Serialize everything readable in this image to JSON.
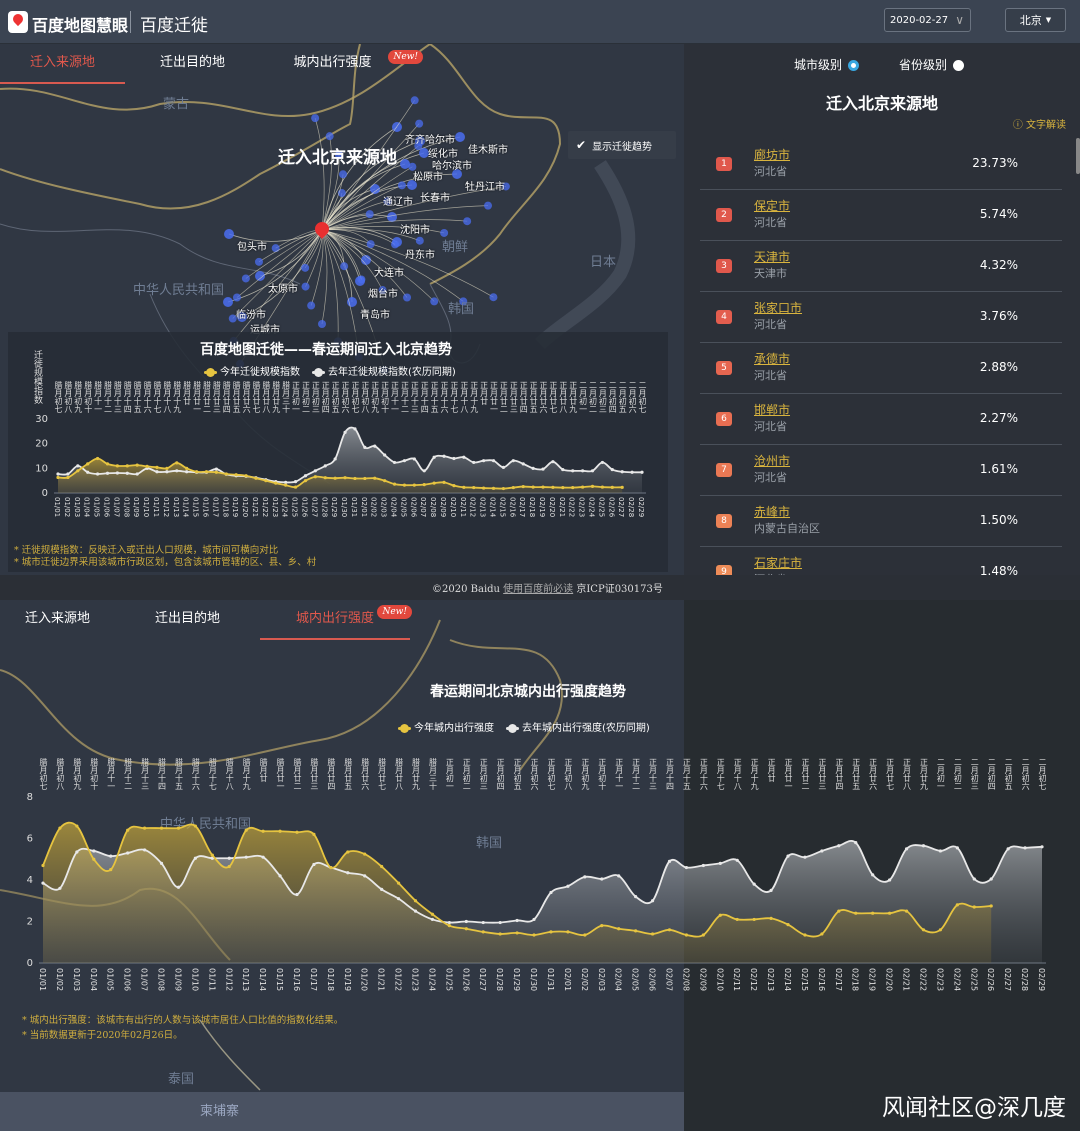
{
  "header": {
    "brand": "百度地图慧眼",
    "title": "百度迁徙",
    "date": "2020-02-27",
    "city": "北京"
  },
  "tabs": [
    {
      "label": "迁入来源地"
    },
    {
      "label": "迁出目的地"
    },
    {
      "label": "城内出行强度",
      "badge": "New!"
    }
  ],
  "top_map": {
    "title": "迁入北京来源地",
    "trend_toggle": "显示迁徙趋势",
    "countries": [
      "蒙古",
      "中华人民共和国",
      "朝鲜",
      "韩国",
      "日本"
    ],
    "cities": [
      "齐齐哈尔市",
      "绥化市",
      "佳木斯市",
      "哈尔滨市",
      "松原市",
      "牡丹江市",
      "长春市",
      "通辽市",
      "沈阳市",
      "丹东市",
      "大连市",
      "烟台市",
      "青岛市",
      "包头市",
      "太原市",
      "临汾市",
      "运城市"
    ]
  },
  "migration_chart": {
    "title": "百度地图迁徙——春运期间迁入北京趋势",
    "notes": [
      "* 迁徙规模指数：反映迁入或迁出人口规模，城市间可横向对比",
      "* 城市迁徙边界采用该城市行政区划，包含该城市管辖的区、县、乡、村"
    ]
  },
  "right_panel": {
    "level_city": "城市级别",
    "level_province": "省份级别",
    "title": "迁入北京来源地",
    "explain": "文字解读",
    "rows": [
      {
        "rank": "1",
        "city": "廊坊市",
        "province": "河北省",
        "pct": "23.73%"
      },
      {
        "rank": "2",
        "city": "保定市",
        "province": "河北省",
        "pct": "5.74%"
      },
      {
        "rank": "3",
        "city": "天津市",
        "province": "天津市",
        "pct": "4.32%"
      },
      {
        "rank": "4",
        "city": "张家口市",
        "province": "河北省",
        "pct": "3.76%"
      },
      {
        "rank": "5",
        "city": "承德市",
        "province": "河北省",
        "pct": "2.88%"
      },
      {
        "rank": "6",
        "city": "邯郸市",
        "province": "河北省",
        "pct": "2.27%"
      },
      {
        "rank": "7",
        "city": "沧州市",
        "province": "河北省",
        "pct": "1.61%"
      },
      {
        "rank": "8",
        "city": "赤峰市",
        "province": "内蒙古自治区",
        "pct": "1.50%"
      },
      {
        "rank": "9",
        "city": "石家庄市",
        "province": "河北省",
        "pct": "1.48%"
      }
    ]
  },
  "footer": {
    "copyright": "©2020 Baidu",
    "link": "使用百度前必读",
    "icp": "京ICP证030173号"
  },
  "bottom_map": {
    "countries": [
      "中华人民共和国",
      "韩国",
      "泰国",
      "柬埔寨"
    ]
  },
  "intensity_chart": {
    "notes": [
      "* 城内出行强度：该城市有出行的人数与该城市居住人口比值的指数化结果。",
      "* 当前数据更新于2020年02月26日。"
    ]
  },
  "watermark": "风闻社区@深几度",
  "colors": {
    "accent": "#e0584c",
    "this_year": "#e6c440",
    "last_year": "#e8e8e8",
    "link": "#d9b43e"
  },
  "chart_data": [
    {
      "type": "area",
      "title": "百度地图迁徙——春运期间迁入北京趋势",
      "ylabel": "迁徙规模指数",
      "ylim": [
        0,
        30
      ],
      "yticks": [
        0,
        10,
        20,
        30
      ],
      "grid": false,
      "legend": "top",
      "categories": [
        "01/01",
        "01/02",
        "01/03",
        "01/04",
        "01/05",
        "01/06",
        "01/07",
        "01/08",
        "01/09",
        "01/10",
        "01/11",
        "01/12",
        "01/13",
        "01/14",
        "01/15",
        "01/16",
        "01/17",
        "01/18",
        "01/19",
        "01/20",
        "01/21",
        "01/22",
        "01/23",
        "01/24",
        "01/25",
        "01/26",
        "01/27",
        "01/28",
        "01/29",
        "01/30",
        "01/31",
        "02/01",
        "02/02",
        "02/03",
        "02/04",
        "02/05",
        "02/06",
        "02/07",
        "02/08",
        "02/09",
        "02/10",
        "02/11",
        "02/12",
        "02/13",
        "02/14",
        "02/15",
        "02/16",
        "02/17",
        "02/18",
        "02/19",
        "02/20",
        "02/21",
        "02/22",
        "02/23",
        "02/24",
        "02/25",
        "02/26",
        "02/27",
        "02/28",
        "02/29"
      ],
      "lunar_categories": [
        "腊月初七",
        "腊月初八",
        "腊月初九",
        "腊月初十",
        "腊月十一",
        "腊月十二",
        "腊月十三",
        "腊月十四",
        "腊月十五",
        "腊月十六",
        "腊月十七",
        "腊月十八",
        "腊月十九",
        "腊月廿",
        "腊月廿一",
        "腊月廿二",
        "腊月廿三",
        "腊月廿四",
        "腊月廿五",
        "腊月廿六",
        "腊月廿七",
        "腊月廿八",
        "腊月廿九",
        "腊月三十",
        "正月初一",
        "正月初二",
        "正月初三",
        "正月初四",
        "正月初五",
        "正月初六",
        "正月初七",
        "正月初八",
        "正月初九",
        "正月初十",
        "正月十一",
        "正月十二",
        "正月十三",
        "正月十四",
        "正月十五",
        "正月十六",
        "正月十七",
        "正月十八",
        "正月十九",
        "正月廿",
        "正月廿一",
        "正月廿二",
        "正月廿三",
        "正月廿四",
        "正月廿五",
        "正月廿六",
        "正月廿七",
        "正月廿八",
        "正月廿九",
        "二月初一",
        "二月初二",
        "二月初三",
        "二月初四",
        "二月初五",
        "二月初六",
        "二月初七"
      ],
      "series": [
        {
          "name": "去年迁徙规模指数(农历同期)",
          "color": "#e8e8e8",
          "values": [
            7.7,
            7.7,
            11,
            8.4,
            7.7,
            8,
            8.1,
            8,
            7.7,
            10,
            8.6,
            8.6,
            9,
            8.6,
            8.4,
            8.4,
            9.7,
            7.6,
            7,
            6.8,
            6.2,
            5.4,
            4.6,
            4.3,
            4.6,
            7,
            9,
            11,
            13.8,
            24.6,
            26,
            18.5,
            19,
            15.4,
            12.4,
            13.1,
            13.8,
            9,
            14.5,
            14.9,
            14,
            14.5,
            12.4,
            13.1,
            13.1,
            10.4,
            13.1,
            11.8,
            10,
            9.7,
            12.7,
            9.5,
            9,
            9,
            9,
            12.4,
            9.5,
            8.6,
            8.4,
            8.4
          ]
        },
        {
          "name": "今年迁徙规模指数",
          "color": "#e6c440",
          "values": [
            6.3,
            6.3,
            9,
            11.8,
            14,
            11.8,
            11,
            11,
            11.3,
            10.8,
            10.4,
            10,
            12.2,
            10,
            8.6,
            8.6,
            8.4,
            7.7,
            7.4,
            7,
            6,
            5,
            4,
            3.2,
            2.4,
            5,
            6.6,
            6.2,
            6,
            6.2,
            5.9,
            5.9,
            6,
            5,
            3.6,
            3.2,
            3.2,
            3.4,
            4,
            4.3,
            3,
            2.3,
            2.2,
            2,
            1.9,
            1.8,
            2.2,
            2.6,
            2.4,
            2.4,
            2.3,
            2.2,
            2.2,
            2.4,
            2.7,
            2.4,
            2.3,
            2.3
          ]
        }
      ]
    },
    {
      "type": "area",
      "title": "春运期间北京城内出行强度趋势",
      "ylim": [
        0,
        8
      ],
      "yticks": [
        0,
        2,
        4,
        6,
        8
      ],
      "grid": false,
      "legend": "top",
      "categories": [
        "01/01",
        "01/02",
        "01/03",
        "01/04",
        "01/05",
        "01/06",
        "01/07",
        "01/08",
        "01/09",
        "01/10",
        "01/11",
        "01/12",
        "01/13",
        "01/14",
        "01/15",
        "01/16",
        "01/17",
        "01/18",
        "01/19",
        "01/20",
        "01/21",
        "01/22",
        "01/23",
        "01/24",
        "01/25",
        "01/26",
        "01/27",
        "01/28",
        "01/29",
        "01/30",
        "01/31",
        "02/01",
        "02/02",
        "02/03",
        "02/04",
        "02/05",
        "02/06",
        "02/07",
        "02/08",
        "02/09",
        "02/10",
        "02/11",
        "02/12",
        "02/13",
        "02/14",
        "02/15",
        "02/16",
        "02/17",
        "02/18",
        "02/19",
        "02/20",
        "02/21",
        "02/22",
        "02/23",
        "02/24",
        "02/25",
        "02/26",
        "02/27",
        "02/28",
        "02/29"
      ],
      "lunar_categories": [
        "腊月初七",
        "腊月初八",
        "腊月初九",
        "腊月初十",
        "腊月十一",
        "腊月十二",
        "腊月十三",
        "腊月十四",
        "腊月十五",
        "腊月十六",
        "腊月十七",
        "腊月十八",
        "腊月十九",
        "腊月廿",
        "腊月廿一",
        "腊月廿二",
        "腊月廿三",
        "腊月廿四",
        "腊月廿五",
        "腊月廿六",
        "腊月廿七",
        "腊月廿八",
        "腊月廿九",
        "腊月三十",
        "正月初一",
        "正月初二",
        "正月初三",
        "正月初四",
        "正月初五",
        "正月初六",
        "正月初七",
        "正月初八",
        "正月初九",
        "正月初十",
        "正月十一",
        "正月十二",
        "正月十三",
        "正月十四",
        "正月十五",
        "正月十六",
        "正月十七",
        "正月十八",
        "正月十九",
        "正月廿",
        "正月廿一",
        "正月廿二",
        "正月廿三",
        "正月廿四",
        "正月廿五",
        "正月廿六",
        "正月廿七",
        "正月廿八",
        "正月廿九",
        "二月初一",
        "二月初二",
        "二月初三",
        "二月初四",
        "二月初五",
        "二月初六",
        "二月初七"
      ],
      "series": [
        {
          "name": "去年城内出行强度(农历同期)",
          "color": "#e8e8e8",
          "values": [
            3.85,
            3.6,
            5.35,
            5.4,
            5.15,
            5.3,
            5.45,
            4.8,
            3.65,
            5.05,
            5.05,
            5.05,
            5.1,
            5.1,
            4.2,
            3.3,
            4.75,
            4.6,
            4.35,
            4.2,
            3.55,
            3.1,
            2.5,
            2.1,
            1.95,
            2.0,
            1.95,
            1.95,
            2.05,
            2.1,
            3.4,
            3.7,
            4.15,
            4.05,
            4.2,
            3.2,
            3.0,
            4.9,
            4.6,
            4.7,
            4.8,
            4.95,
            3.8,
            3.5,
            5.15,
            5.1,
            5.4,
            5.65,
            5.8,
            4.25,
            4.0,
            5.5,
            5.65,
            5.4,
            5.55,
            4.05,
            4.05,
            5.5,
            5.55,
            5.6
          ]
        },
        {
          "name": "今年城内出行强度",
          "color": "#e6c440",
          "values": [
            4.7,
            6.5,
            6.6,
            5.0,
            4.5,
            6.4,
            6.5,
            6.5,
            6.5,
            6.6,
            5.2,
            4.65,
            6.4,
            6.35,
            6.35,
            6.3,
            6.2,
            4.6,
            5.35,
            5.25,
            4.65,
            3.85,
            3.0,
            2.35,
            1.8,
            1.65,
            1.5,
            1.4,
            1.45,
            1.35,
            1.5,
            1.5,
            1.35,
            1.8,
            1.65,
            1.55,
            1.4,
            1.6,
            1.35,
            1.35,
            2.3,
            2.1,
            2.1,
            2.15,
            1.85,
            1.35,
            1.4,
            2.5,
            2.4,
            2.4,
            2.4,
            2.5,
            1.6,
            1.6,
            2.8,
            2.7,
            2.75
          ]
        }
      ]
    }
  ]
}
